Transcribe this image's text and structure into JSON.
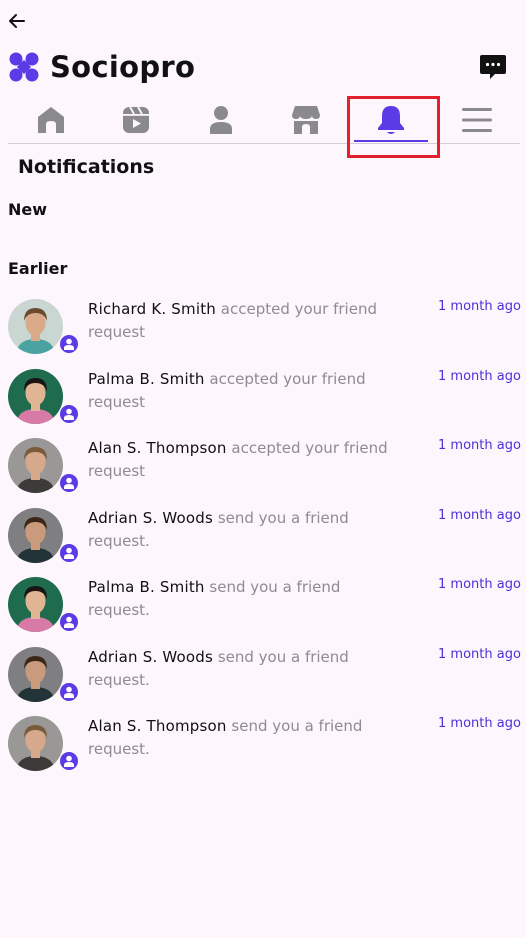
{
  "app": {
    "title": "Sociopro"
  },
  "header": {
    "back_icon": "arrow-left-icon",
    "chat_icon": "chat-bubble-icon"
  },
  "nav": {
    "tabs": [
      {
        "name": "home",
        "icon": "home-icon",
        "active": false
      },
      {
        "name": "videos",
        "icon": "video-icon",
        "active": false
      },
      {
        "name": "profile",
        "icon": "person-icon",
        "active": false
      },
      {
        "name": "marketplace",
        "icon": "store-icon",
        "active": false
      },
      {
        "name": "notifications",
        "icon": "bell-icon",
        "active": true
      },
      {
        "name": "menu",
        "icon": "menu-icon",
        "active": false
      }
    ]
  },
  "page": {
    "title": "Notifications"
  },
  "sections": {
    "new": "New",
    "earlier": "Earlier"
  },
  "colors": {
    "accent": "#5a3be6",
    "background": "#fdf6fd",
    "muted_text": "#8f8a94",
    "highlight": "#e3202c"
  },
  "notifications": [
    {
      "name": "Richard K. Smith",
      "message": "accepted your friend request",
      "time": "1 month ago"
    },
    {
      "name": "Palma B. Smith",
      "message": "accepted your friend request",
      "time": "1 month ago"
    },
    {
      "name": "Alan S. Thompson",
      "message": "accepted your friend request",
      "time": "1 month ago"
    },
    {
      "name": "Adrian S. Woods",
      "message": "send you a friend request.",
      "time": "1 month ago"
    },
    {
      "name": "Palma B. Smith",
      "message": "send you a friend request.",
      "time": "1 month ago"
    },
    {
      "name": "Adrian S. Woods",
      "message": "send you a friend request.",
      "time": "1 month ago"
    },
    {
      "name": "Alan S. Thompson",
      "message": "send you a friend request.",
      "time": "1 month ago"
    }
  ]
}
